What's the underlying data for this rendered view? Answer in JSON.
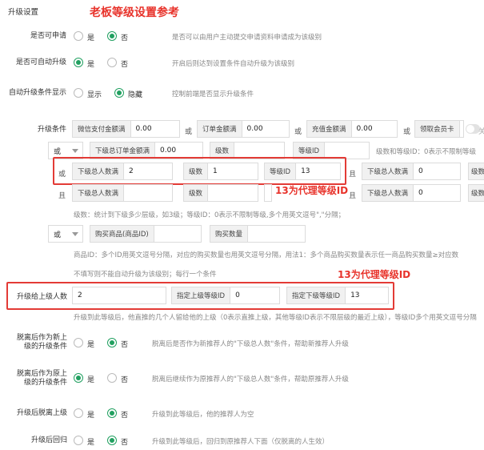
{
  "section_title": "升级设置",
  "annotation_top": "老板等级设置参考",
  "annotation_mid": "13为代理等级ID",
  "annotation_bottom": "13为代理等级ID",
  "options": {
    "yes": "是",
    "no": "否",
    "show": "显示",
    "hide": "隐藏"
  },
  "apply": {
    "label": "是否可申请",
    "hint": "是否可以由用户主动提交申请资料申请成为该级别"
  },
  "auto": {
    "label": "是否可自动升级",
    "hint": "开启后则达到设置条件自动升级为该级别"
  },
  "cond_show": {
    "label": "自动升级条件显示",
    "hint": "控制前端是否显示升级条件"
  },
  "conditions": {
    "label": "升级条件",
    "or": "或",
    "and": "且",
    "wechat_addon": "微信支付金额满",
    "wechat_val": "0.00",
    "order_addon": "订单金额满",
    "order_val": "0.00",
    "recharge_addon": "充值金额满",
    "recharge_val": "0.00",
    "member_card_addon": "领取会员卡",
    "member_card_toggle": "关闭",
    "rowA_select": "或",
    "sub_order_addon": "下级总订单金额满",
    "sub_order_val": "0.00",
    "level_count_addon": "级数",
    "level_id_addon": "等级ID",
    "rowA_hint": "级数和等级ID：0表示不限制等级",
    "rowB_addon": "下级总人数满",
    "rowB_val": "2",
    "rowB_level": "级数",
    "rowB_level_val": "1",
    "rowB_id": "等级ID",
    "rowB_id_val": "13",
    "rowB_right_addon": "下级总人数满",
    "rowB_right_val": "0",
    "rowB_right_more": "级数",
    "rowC_addon": "下级总人数满",
    "rowC_level": "级数",
    "rowC_id": "等级ID",
    "rowC_right_addon": "下级总人数满",
    "rowC_right_val": "0",
    "rowC_right_more": "级数",
    "levels_hint": "级数：统计到下级多少层级，如3级；等级ID：0表示不限制等级,多个用英文逗号\",\"分隔；",
    "goods_select": "或",
    "goods_addon": "购买商品(商品ID)",
    "goods_qty_addon": "购买数量",
    "goods_hint": "商品ID：多个ID用英文逗号分隔，对应的购买数量也用英文逗号分隔，用法1：多个商品购买数量表示任一商品购买数量≥对应数",
    "fill_hint": "不填写则不能自动升级为该级别；每行一个条件"
  },
  "upgrade_parent": {
    "label": "升级给上级人数",
    "val": "2",
    "parent_id_addon": "指定上级等级ID",
    "parent_id_val": "0",
    "child_id_addon": "指定下级等级ID",
    "child_id_val": "13",
    "hint": "升级到此等级后，他直推的几个人留给他的上级（0表示直推上级，其他等级ID表示不限层级的最近上级），等级ID多个用英文逗号分隔"
  },
  "detach_new": {
    "label": "脱离后作为新上级的升级条件",
    "hint": "脱离后是否作为新推荐人的\"下级总人数\"条件，帮助新推荐人升级"
  },
  "detach_old": {
    "label": "脱离后作为原上级的升级条件",
    "hint": "脱离后继续作为原推荐人的\"下级总人数\"条件，帮助原推荐人升级"
  },
  "detach_after": {
    "label": "升级后脱离上级",
    "hint": "升级到此等级后，他的推荐人为空"
  },
  "return_after": {
    "label": "升级后回归",
    "hint": "升级到此等级后，回归到原推荐人下面（仅脱离的人生效）"
  },
  "colors": {
    "accent": "#21a060",
    "annotation": "#e8332b"
  }
}
